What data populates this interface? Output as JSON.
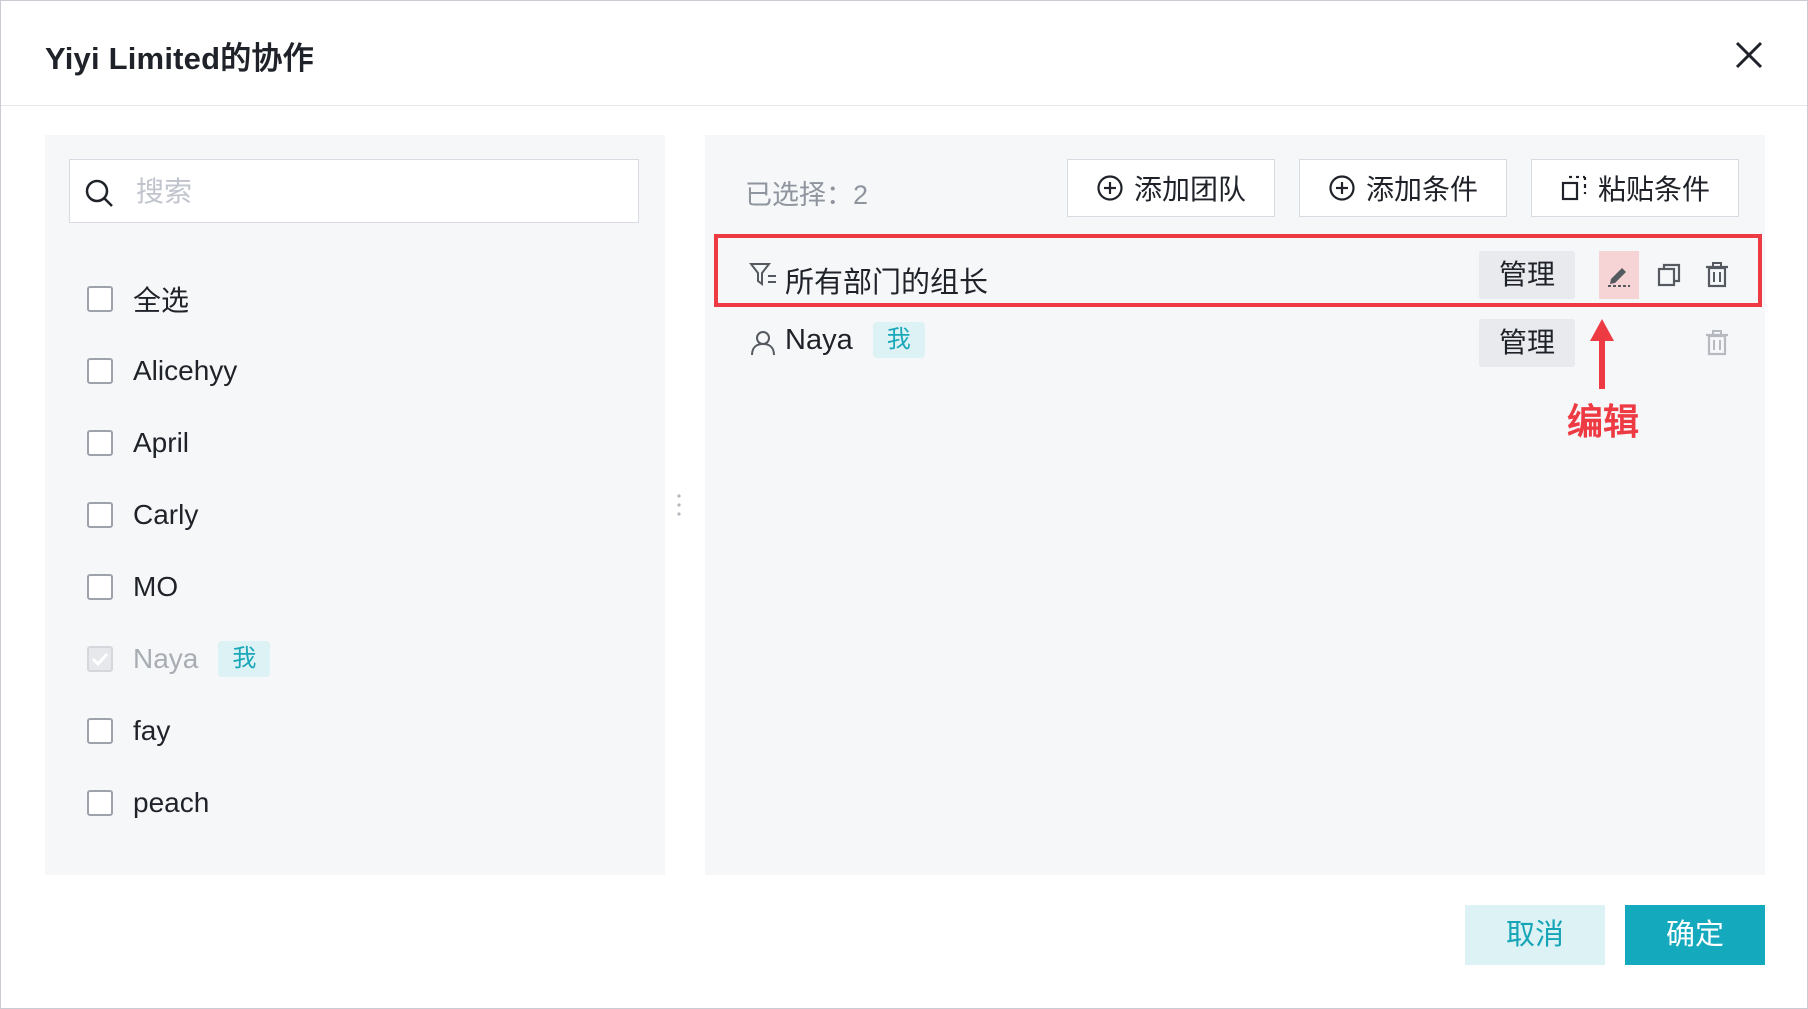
{
  "dialog": {
    "title": "Yiyi Limited的协作"
  },
  "search": {
    "placeholder": "搜索"
  },
  "members": [
    {
      "label": "全选",
      "checked": false,
      "disabled": false,
      "me_tag": ""
    },
    {
      "label": "Alicehyy",
      "checked": false,
      "disabled": false,
      "me_tag": ""
    },
    {
      "label": "April",
      "checked": false,
      "disabled": false,
      "me_tag": ""
    },
    {
      "label": "Carly",
      "checked": false,
      "disabled": false,
      "me_tag": ""
    },
    {
      "label": "MO",
      "checked": false,
      "disabled": false,
      "me_tag": ""
    },
    {
      "label": "Naya",
      "checked": true,
      "disabled": true,
      "me_tag": "我"
    },
    {
      "label": "fay",
      "checked": false,
      "disabled": false,
      "me_tag": ""
    },
    {
      "label": "peach",
      "checked": false,
      "disabled": false,
      "me_tag": ""
    }
  ],
  "selected": {
    "count_label": "已选择：2"
  },
  "toolbar": {
    "add_team": "添加团队",
    "add_condition": "添加条件",
    "paste_condition": "粘贴条件"
  },
  "rows": [
    {
      "label": "所有部门的组长",
      "icon": "filter-icon",
      "manage_label": "管理"
    },
    {
      "label": "Naya",
      "icon": "user-icon",
      "me_tag": "我",
      "manage_label": "管理"
    }
  ],
  "annotation": {
    "label": "编辑",
    "color": "#ee3b43"
  },
  "footer": {
    "cancel": "取消",
    "confirm": "确定"
  },
  "colors": {
    "accent": "#14a9bd",
    "highlight": "#ee3b43"
  }
}
